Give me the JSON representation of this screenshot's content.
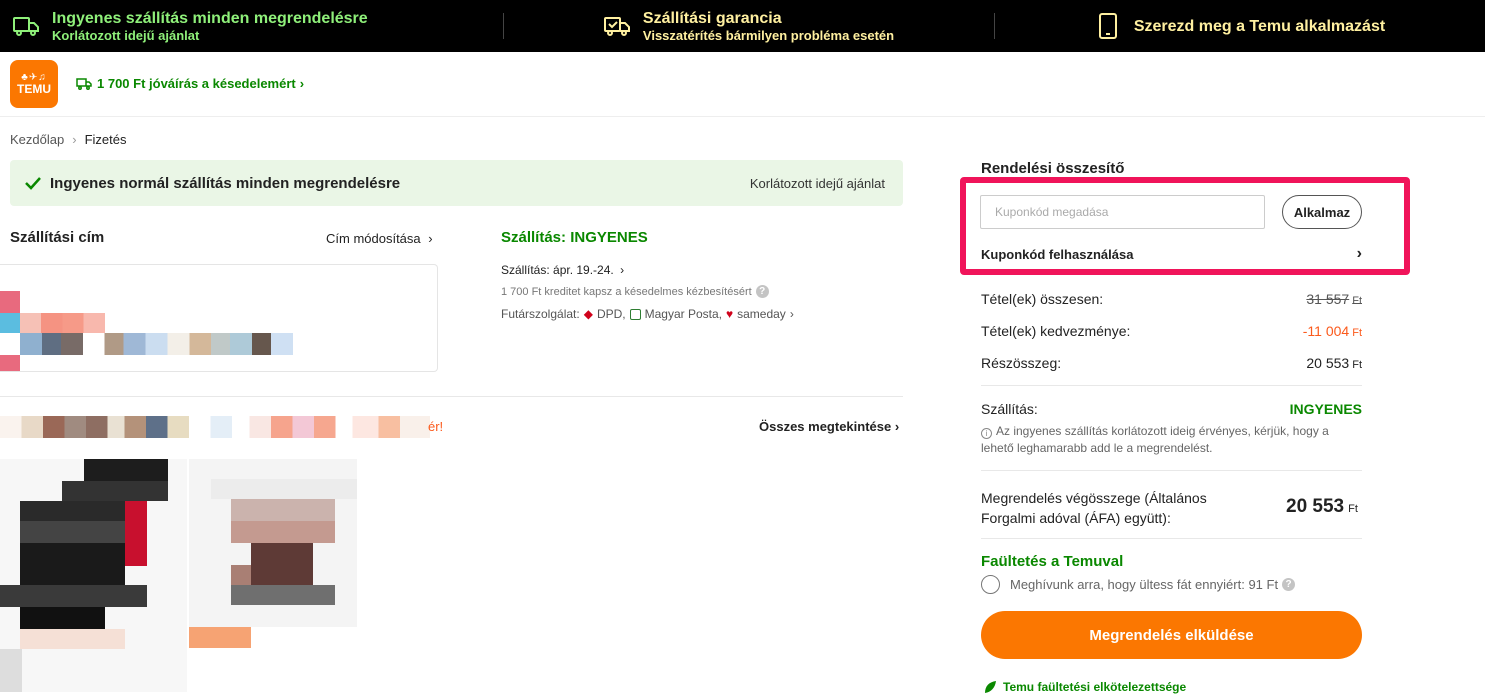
{
  "colors": {
    "brand_orange": "#fb7701",
    "green": "#0a8800",
    "highlight_pink": "#f0145a",
    "discount_orange": "#fb5a1c"
  },
  "topbar": {
    "free_shipping_title": "Ingyenes szállítás minden megrendelésre",
    "free_shipping_sub": "Korlátozott idejű ajánlat",
    "guarantee_title": "Szállítási garancia",
    "guarantee_sub": "Visszatérítés bármilyen probléma esetén",
    "app_title": "Szerezd meg a Temu alkalmazást"
  },
  "header": {
    "logo_text": "TEMU",
    "credit_link": "1 700 Ft jóváírás a késedelemért"
  },
  "breadcrumb": {
    "home": "Kezdőlap",
    "current": "Fizetés"
  },
  "promo": {
    "text": "Ingyenes normál szállítás minden megrendelésre",
    "limit": "Korlátozott idejű ajánlat"
  },
  "address": {
    "title": "Szállítási cím",
    "modify": "Cím módosítása"
  },
  "shipping": {
    "title": "Szállítás: INGYENES",
    "date": "Szállítás: ápr. 19.-24.",
    "credit_note": "1 700 Ft kreditet kapsz a késedelmes kézbesítésért",
    "courier_label": "Futárszolgálat:",
    "courier1": "DPD,",
    "courier2": "Magyar Posta,",
    "courier3": "sameday"
  },
  "items": {
    "orange_fragment": "ér!",
    "view_all": "Összes megtekintése"
  },
  "summary": {
    "title": "Rendelési összesítő",
    "coupon_placeholder": "Kuponkód megadása",
    "apply": "Alkalmaz",
    "use_coupon": "Kuponkód felhasználása",
    "items_total_label": "Tétel(ek) összesen:",
    "items_total_value": "31 557",
    "items_discount_label": "Tétel(ek) kedvezménye:",
    "items_discount_value": "-11 004",
    "subtotal_label": "Részösszeg:",
    "subtotal_value": "20 553",
    "currency": "Ft",
    "shipping_label": "Szállítás:",
    "shipping_value": "INGYENES",
    "shipping_note": "Az ingyenes szállítás korlátozott ideig érvényes, kérjük, hogy a lehető leghamarabb add le a megrendelést.",
    "total_label": "Megrendelés végösszege (Általános Forgalmi adóval (ÁFA) együtt):",
    "total_value": "20 553",
    "tree_title": "Faültetés a Temuval",
    "tree_text": "Meghívunk arra, hogy ültess fát ennyiért: 91 Ft",
    "order_button": "Megrendelés elküldése",
    "commitment": "Temu faültetési elkötelezettsége"
  }
}
